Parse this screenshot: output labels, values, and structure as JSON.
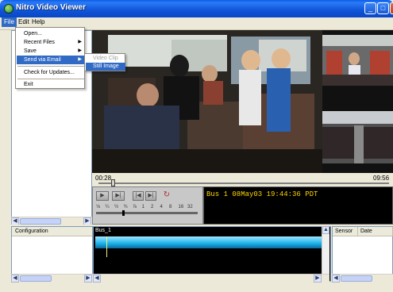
{
  "window": {
    "title": "Nitro Video Viewer",
    "min_glyph": "_",
    "max_glyph": "□",
    "close_glyph": "×"
  },
  "menubar": {
    "items": [
      "File",
      "Edit",
      "Help"
    ]
  },
  "file_menu": {
    "items": [
      {
        "label": "Open...",
        "has_submenu": false,
        "highlighted": false
      },
      {
        "label": "Recent Files",
        "has_submenu": true,
        "highlighted": false
      },
      {
        "label": "Save",
        "has_submenu": true,
        "highlighted": false
      },
      {
        "label": "Send via Email",
        "has_submenu": true,
        "highlighted": true
      },
      {
        "label": "Check for Updates...",
        "has_submenu": false,
        "highlighted": false
      },
      {
        "label": "Exit",
        "has_submenu": false,
        "highlighted": false
      }
    ],
    "arrow_glyph": "▶"
  },
  "send_email_submenu": {
    "items": [
      {
        "label": "Video Clip",
        "disabled": true,
        "highlighted": false
      },
      {
        "label": "Still Image",
        "disabled": false,
        "highlighted": true
      }
    ]
  },
  "playback": {
    "current_time": "00:28",
    "end_time": "09:56",
    "progress_fraction": 0.05,
    "speeds": [
      "⅛",
      "¼",
      "½",
      "¾",
      "⅞",
      "1",
      "2",
      "4",
      "8",
      "16",
      "32"
    ]
  },
  "controls": {
    "play_glyph": "▶",
    "frame_step_glyph": "▶|",
    "prev_glyph": "|◀",
    "next_glyph": "▶|",
    "loop_glyph": "↻"
  },
  "info_display": {
    "text": "Bus 1 08May03 19:44:36 PDT"
  },
  "panels": {
    "configuration_header": "Configuration",
    "timeline_label": "Bus_1",
    "sensor_columns": [
      "Sensor",
      "Date"
    ]
  },
  "scroll": {
    "left_glyph": "◀",
    "right_glyph": "▶",
    "up_glyph": "▲",
    "down_glyph": "▼"
  },
  "colors": {
    "titlebar": "#0a5fe6",
    "menu_highlight": "#316ac5",
    "info_text": "#ffd400",
    "timeline_bar": "#18b0e8"
  }
}
